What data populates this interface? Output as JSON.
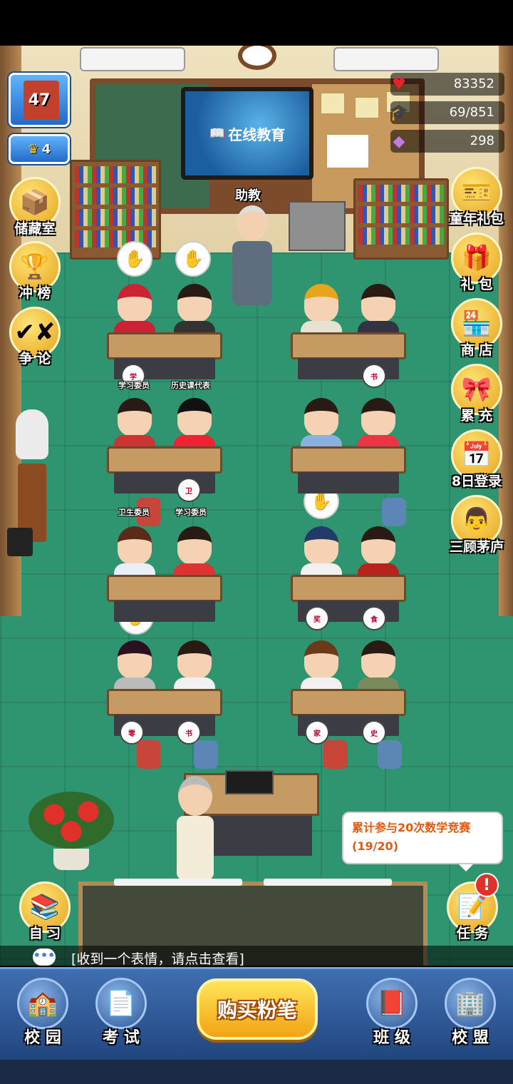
{
  "hud": {
    "hearts": "83352",
    "scholar_points": "69/851",
    "gems": "298",
    "school_level": "47",
    "crown_level": "4"
  },
  "left_buttons": [
    {
      "label": "储藏室",
      "icon": "boxes-icon"
    },
    {
      "label": "冲 榜",
      "icon": "trophy-icon"
    },
    {
      "label": "争 论",
      "icon": "debate-icon"
    }
  ],
  "right_buttons": [
    {
      "label": "童年礼包",
      "icon": "gift-card-icon"
    },
    {
      "label": "礼 包",
      "icon": "gift-box-icon"
    },
    {
      "label": "商 店",
      "icon": "shop-icon"
    },
    {
      "label": "累 充",
      "icon": "gift-pack-icon"
    },
    {
      "label": "8日登录",
      "icon": "calendar-icon"
    },
    {
      "label": "三顾茅庐",
      "icon": "scholar-icon"
    }
  ],
  "scene": {
    "tv_title": "在线教育",
    "assistant_label": "助教",
    "roles": [
      "学习委员",
      "历史课代表",
      "卫生委员",
      "学习委员"
    ]
  },
  "self_study": {
    "label": "自 习"
  },
  "task": {
    "text": "累计参与20次数学竞赛(19/20)",
    "button_label": "任 务",
    "alert": "!"
  },
  "message": "[收到一个表情，请点击查看]",
  "nav": {
    "campus": "校 园",
    "exam": "考 试",
    "buy_chalk": "购买粉笔",
    "class": "班 级",
    "alliance": "校 盟"
  },
  "colors": {
    "floor": "#2f9470",
    "nav": "#2d5796",
    "buy_button": "#f2a312",
    "task_text": "#e05a12"
  }
}
